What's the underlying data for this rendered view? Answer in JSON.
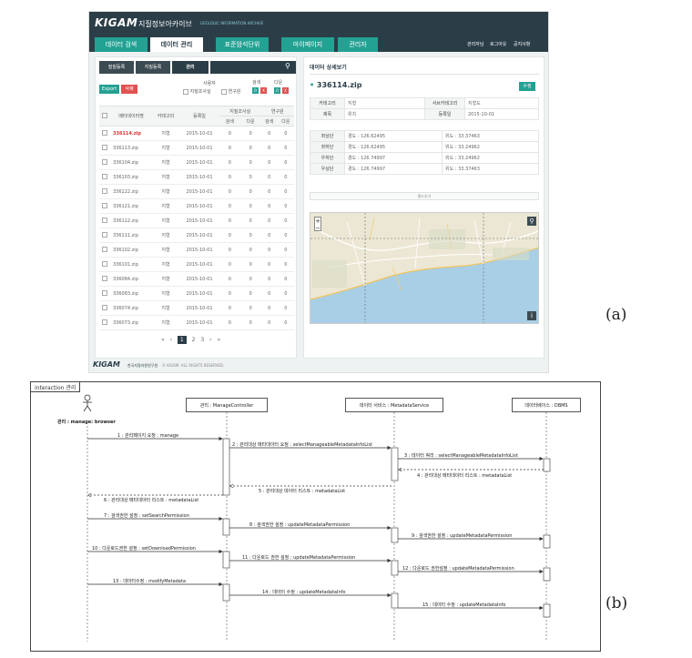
{
  "figure_labels": {
    "a": "(a)",
    "b": "(b)"
  },
  "app": {
    "logo": "KIGAM",
    "title": "지질정보아카이브",
    "subtitle": "GEOLOGIC INFORMATION ARCHIVE",
    "nav": [
      "데이터 검색",
      "데이터 관리",
      "표준암석단위",
      "마이페이지",
      "관리자"
    ],
    "util_links": [
      "관리자님",
      "로그아웃",
      "공지사항"
    ],
    "tabs": [
      "질질등록",
      "지질등록",
      "관리"
    ],
    "search_placeholder": "",
    "export_label": "Export",
    "delete_label": "삭제",
    "user_type_label": "사용자",
    "geo_survey_label": "지질조사실",
    "researcher_label": "연구원",
    "search_label": "검색",
    "download_label": "다운",
    "table_headers": [
      "메타데이터명",
      "카테고리",
      "등록일"
    ],
    "perm_group_headers": [
      "지질조사실",
      "연구원"
    ],
    "perm_sub_headers": [
      "검색",
      "다운",
      "검색",
      "다운"
    ],
    "rows": [
      {
        "name": "336114.zip",
        "cat": "지형",
        "date": "2015-10-01"
      },
      {
        "name": "336113.zip",
        "cat": "지형",
        "date": "2015-10-01"
      },
      {
        "name": "336104.zip",
        "cat": "지형",
        "date": "2015-10-01"
      },
      {
        "name": "336103.zip",
        "cat": "지형",
        "date": "2015-10-01"
      },
      {
        "name": "336122.zip",
        "cat": "지형",
        "date": "2015-10-01"
      },
      {
        "name": "336121.zip",
        "cat": "지형",
        "date": "2015-10-01"
      },
      {
        "name": "336112.zip",
        "cat": "지형",
        "date": "2015-10-01"
      },
      {
        "name": "336111.zip",
        "cat": "지형",
        "date": "2015-10-01"
      },
      {
        "name": "336102.zip",
        "cat": "지형",
        "date": "2015-10-01"
      },
      {
        "name": "336101.zip",
        "cat": "지형",
        "date": "2015-10-01"
      },
      {
        "name": "336084.zip",
        "cat": "지형",
        "date": "2015-10-01"
      },
      {
        "name": "336083.zip",
        "cat": "지형",
        "date": "2015-10-01"
      },
      {
        "name": "336074.zip",
        "cat": "지형",
        "date": "2015-10-01"
      },
      {
        "name": "336073.zip",
        "cat": "지형",
        "date": "2015-10-01"
      }
    ],
    "perm_value": "0",
    "pager": [
      "«",
      "‹",
      "1",
      "2",
      "3",
      "›",
      "»"
    ],
    "detail": {
      "title": "데이터 상세보기",
      "file": "336114.zip",
      "edit_label": "수정",
      "category_key": "카테고리",
      "category_val": "지형",
      "subcategory_key": "서브카테고리",
      "subcategory_val": "지형도",
      "name_key": "제목",
      "name_val": "위치",
      "date_key": "등록일",
      "date_val": "2015-10-01",
      "corners": [
        {
          "k": "좌상단",
          "lon": "경도 : 126.62495",
          "lat": "위도 : 33.37463"
        },
        {
          "k": "좌하단",
          "lon": "경도 : 126.62495",
          "lat": "위도 : 33.24962"
        },
        {
          "k": "우하단",
          "lon": "경도 : 126.74997",
          "lat": "위도 : 33.24962"
        },
        {
          "k": "우상단",
          "lon": "경도 : 126.74997",
          "lat": "위도 : 33.37463"
        }
      ],
      "add_field_label": "필드추가"
    },
    "footer_logo": "KIGAM",
    "footer_inst": "한국지질자원연구원",
    "footer_copy": "© KIGAM. ALL RIGHTS RESERVED."
  },
  "sequence": {
    "frame_title": "interaction 관리",
    "actor": "관리 : manage: browser",
    "lifelines": [
      "관리 : ManageController",
      "데이터 서비스 : MetadataService",
      "데이터베이스 : DBMS"
    ],
    "messages": [
      "1 : 관리페이지 요청 : manage",
      "2 : 관리대상 메타데이터 요청 : selectManageableMetadataInfoList",
      "3 : 데이터 쿼리 : selectManageableMetadataInfoList",
      "4 : 관리대상 메타데이터 리스트 : metadataList",
      "5 : 관리대상 데이터 리스트 : metadataList",
      "6 : 관리대상 메타데이터 리스트 : metadataList",
      "7 : 검색권한 설정 : setSearchPermission",
      "8 : 검색권한 설정 : updateMetadataPermission",
      "9 : 검색권한 설정 : updateMetadataPermission",
      "10 : 다운로드권한 설정 : setDownloadPermission",
      "11 : 다운로드 권한 설정 : updateMetadataPermission",
      "12 : 다운로드 권한설정 : updateMetadataPermission",
      "13 : 데이터수정 : modifyMetadata",
      "14 : 데이터 수정 : updateMetadataInfo",
      "15 : 데이터 수정 : updateMetadataInfo"
    ]
  },
  "colors": {
    "header": "#2b3e48",
    "accent": "#23a193",
    "danger": "#d33"
  }
}
